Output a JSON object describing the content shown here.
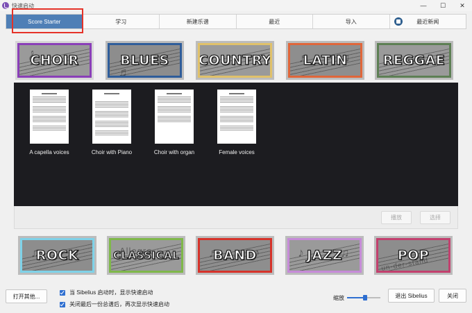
{
  "window": {
    "title": "快速启动",
    "controls": [
      "—",
      "☐",
      "✕"
    ]
  },
  "tabs": [
    {
      "label": "Score Starter"
    },
    {
      "label": "学习"
    },
    {
      "label": "新建乐谱"
    },
    {
      "label": "最近"
    },
    {
      "label": "导入"
    },
    {
      "label": "最近新闻"
    }
  ],
  "genres_top": [
    {
      "label": "CHOIR",
      "border": "#8a3fb8",
      "bg": "#9a9a9a",
      "notes": "𝄞 ♩ ♪"
    },
    {
      "label": "BLUES",
      "border": "#2f5d9a",
      "bg": "#8d8d8d",
      "notes": "♫ ♩ ♬"
    },
    {
      "label": "COUNTRY",
      "border": "#e0c16a",
      "bg": "#9a9a9a",
      "notes": "♪ ♫ ♩"
    },
    {
      "label": "LATIN",
      "border": "#e0663a",
      "bg": "#8e8e8e",
      "notes": "♬ ♪ ♫"
    },
    {
      "label": "REGGAE",
      "border": "#5d7f54",
      "bg": "#9a9a9a",
      "notes": "♩ ♬ ♪"
    }
  ],
  "genres_bottom": [
    {
      "label": "ROCK",
      "border": "#7fd2e8",
      "bg": "#8d8d8d",
      "notes": "♫ ♪ ♬"
    },
    {
      "label": "CLASSICAL",
      "border": "#7fb84a",
      "bg": "#9a9a9a",
      "notes": "Allegro ♩"
    },
    {
      "label": "BAND",
      "border": "#d6332b",
      "bg": "#8e8e8e",
      "notes": "♬ ♫ ♪"
    },
    {
      "label": "JAZZ",
      "border": "#c68bd8",
      "bg": "#9a9a9a",
      "notes": "♪ ♩ ♫"
    },
    {
      "label": "POP",
      "border": "#c2406e",
      "bg": "#8d8d8d",
      "notes": "un-der-stand"
    }
  ],
  "templates": [
    {
      "label": "A capella voices"
    },
    {
      "label": "Choir with Piano"
    },
    {
      "label": "Choir with organ"
    },
    {
      "label": "Female voices"
    }
  ],
  "actions": {
    "play": "播放",
    "select": "选择"
  },
  "footer": {
    "open_other": "打开其他...",
    "show_on_start": "当 Sibelius 启动时，显示快速启动",
    "show_after_close": "关闭最后一份总谱后，再次显示快速启动",
    "zoom_label": "缩放",
    "zoom_level": 0.55,
    "quit": "退出 Sibelius",
    "close": "关闭"
  },
  "colors": {
    "accent": "#4f7fb6",
    "highlight": "#e53228",
    "panel": "#1c1c20"
  }
}
